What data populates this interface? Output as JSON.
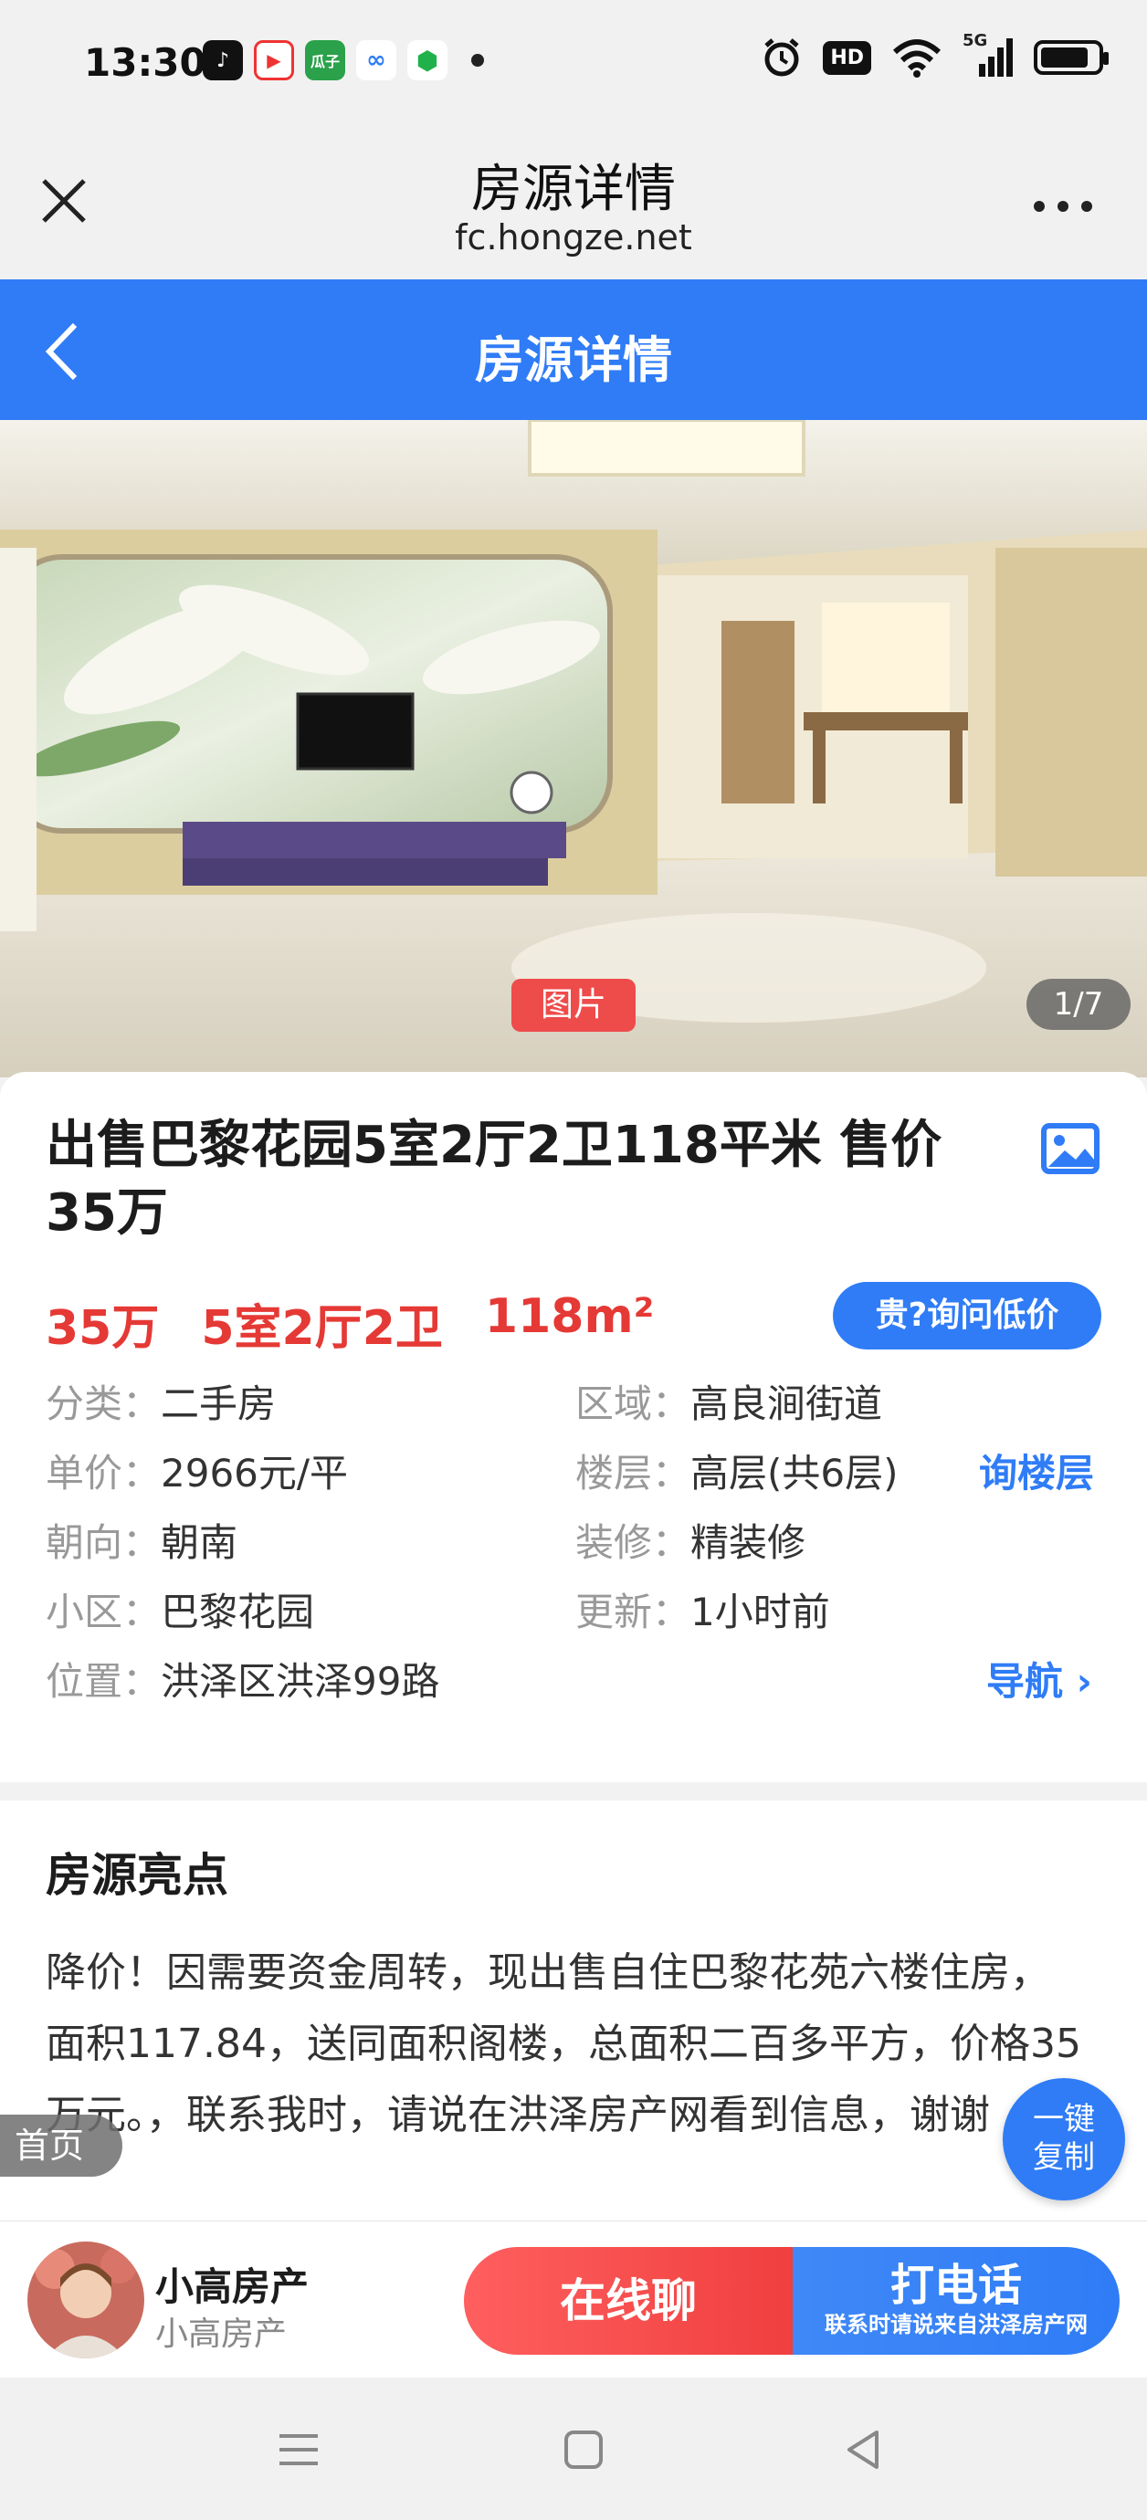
{
  "status_bar": {
    "time": "13:30",
    "app_icon_badge": "瓜子",
    "hd_badge": "HD",
    "network": "5G",
    "battery_level": 0.85
  },
  "browser": {
    "title": "房源详情",
    "url": "fc.hongze.net"
  },
  "page_header": {
    "title": "房源详情"
  },
  "photo": {
    "tag": "图片",
    "counter": "1/7"
  },
  "listing": {
    "title": "出售巴黎花园5室2厅2卫118平米 售价35万",
    "price": "35万",
    "layout": "5室2厅2卫",
    "area": "118m²",
    "ask_low_price_label": "贵?询问低价",
    "attributes": [
      {
        "key": "分类：",
        "value": "二手房"
      },
      {
        "key": "区域：",
        "value": "高良涧街道"
      },
      {
        "key": "单价：",
        "value": "2966元/平"
      },
      {
        "key": "楼层：",
        "value": "高层(共6层)"
      },
      {
        "key": "朝向：",
        "value": "朝南"
      },
      {
        "key": "装修：",
        "value": "精装修"
      },
      {
        "key": "小区：",
        "value": "巴黎花园"
      },
      {
        "key": "更新：",
        "value": "1小时前"
      },
      {
        "key": "位置：",
        "value": "洪泽区洪泽99路"
      }
    ],
    "ask_floor_label": "询楼层",
    "navigate_label": "导航"
  },
  "highlights": {
    "title": "房源亮点",
    "body": "降价！因需要资金周转，现出售自住巴黎花苑六楼住房，面积117.84，送同面积阁楼，总面积二百多平方，价格35万元。，联系我时，请说在洪泽房产网看到信息，谢谢"
  },
  "floating": {
    "home_label": "首页",
    "copy_label_1": "一键",
    "copy_label_2": "复制"
  },
  "contact": {
    "agent_name": "小高房产",
    "agent_sub": "小高房产",
    "chat_label": "在线聊",
    "call_label": "打电话",
    "call_sub": "联系时请说来自洪泽房产网"
  },
  "colors": {
    "brand_blue": "#2f7cf6",
    "accent_red": "#e53935"
  }
}
